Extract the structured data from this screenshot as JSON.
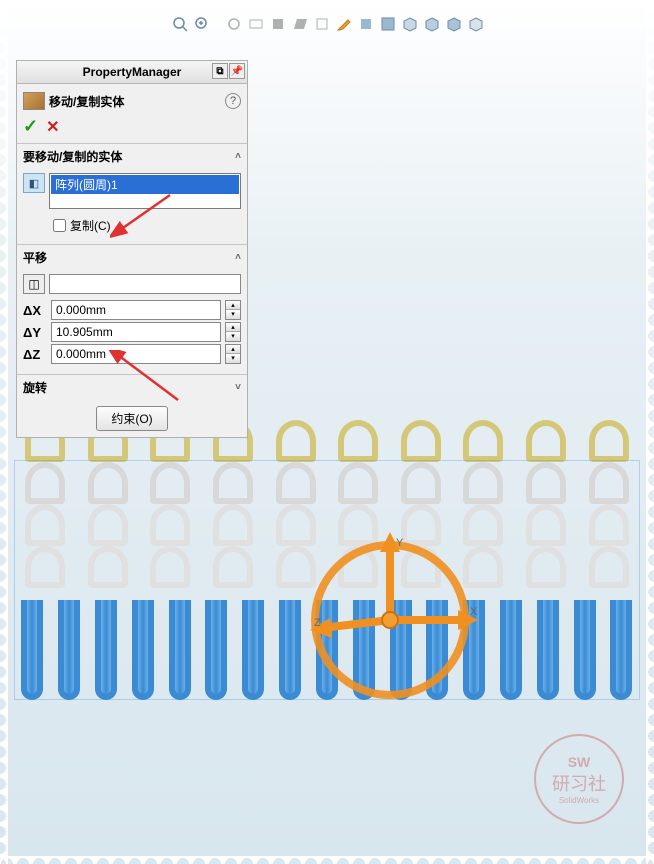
{
  "pm": {
    "header": "PropertyManager",
    "title": "移动/复制实体",
    "help": "?",
    "sections": {
      "bodies": {
        "header": "要移动/复制的实体",
        "selected_item": "阵列(圆周)1",
        "copy_label": "复制(C)"
      },
      "translate": {
        "header": "平移",
        "dx_label": "ΔX",
        "dy_label": "ΔY",
        "dz_label": "ΔZ",
        "dx": "0.000mm",
        "dy": "10.905mm",
        "dz": "0.000mm"
      },
      "rotate": {
        "header": "旋转"
      },
      "constraint_button": "约束(O)"
    }
  },
  "triad": {
    "x": "X",
    "y": "Y",
    "z": "Z"
  },
  "watermark": {
    "sw": "SW",
    "txt": "研习社",
    "sub": "SolidWorks"
  }
}
